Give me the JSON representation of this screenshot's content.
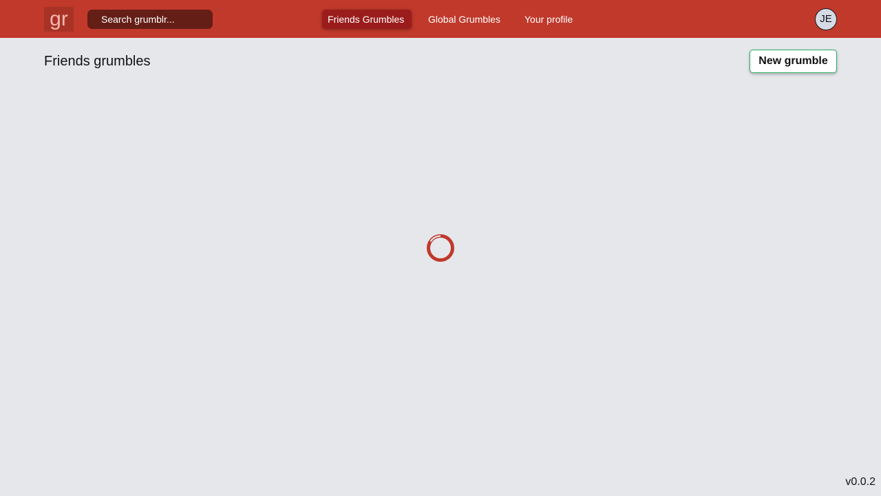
{
  "app": {
    "logo_text": "gr",
    "version": "v0.0.2"
  },
  "search": {
    "placeholder": "Search grumblr...",
    "value": ""
  },
  "nav": {
    "tabs": [
      {
        "label": "Friends Grumbles",
        "active": true
      },
      {
        "label": "Global Grumbles",
        "active": false
      },
      {
        "label": "Your profile",
        "active": false
      }
    ]
  },
  "user": {
    "initials": "JE"
  },
  "main": {
    "title": "Friends grumbles",
    "new_button_label": "New grumble",
    "loading": true
  },
  "colors": {
    "brand": "#c0392b",
    "search_bg": "#641e16",
    "active_tab": "#9b1c1c",
    "page_bg": "#e5e7eb",
    "accent_green": "#27ae60"
  },
  "icons": {
    "spinner": "loading-spinner-icon"
  }
}
